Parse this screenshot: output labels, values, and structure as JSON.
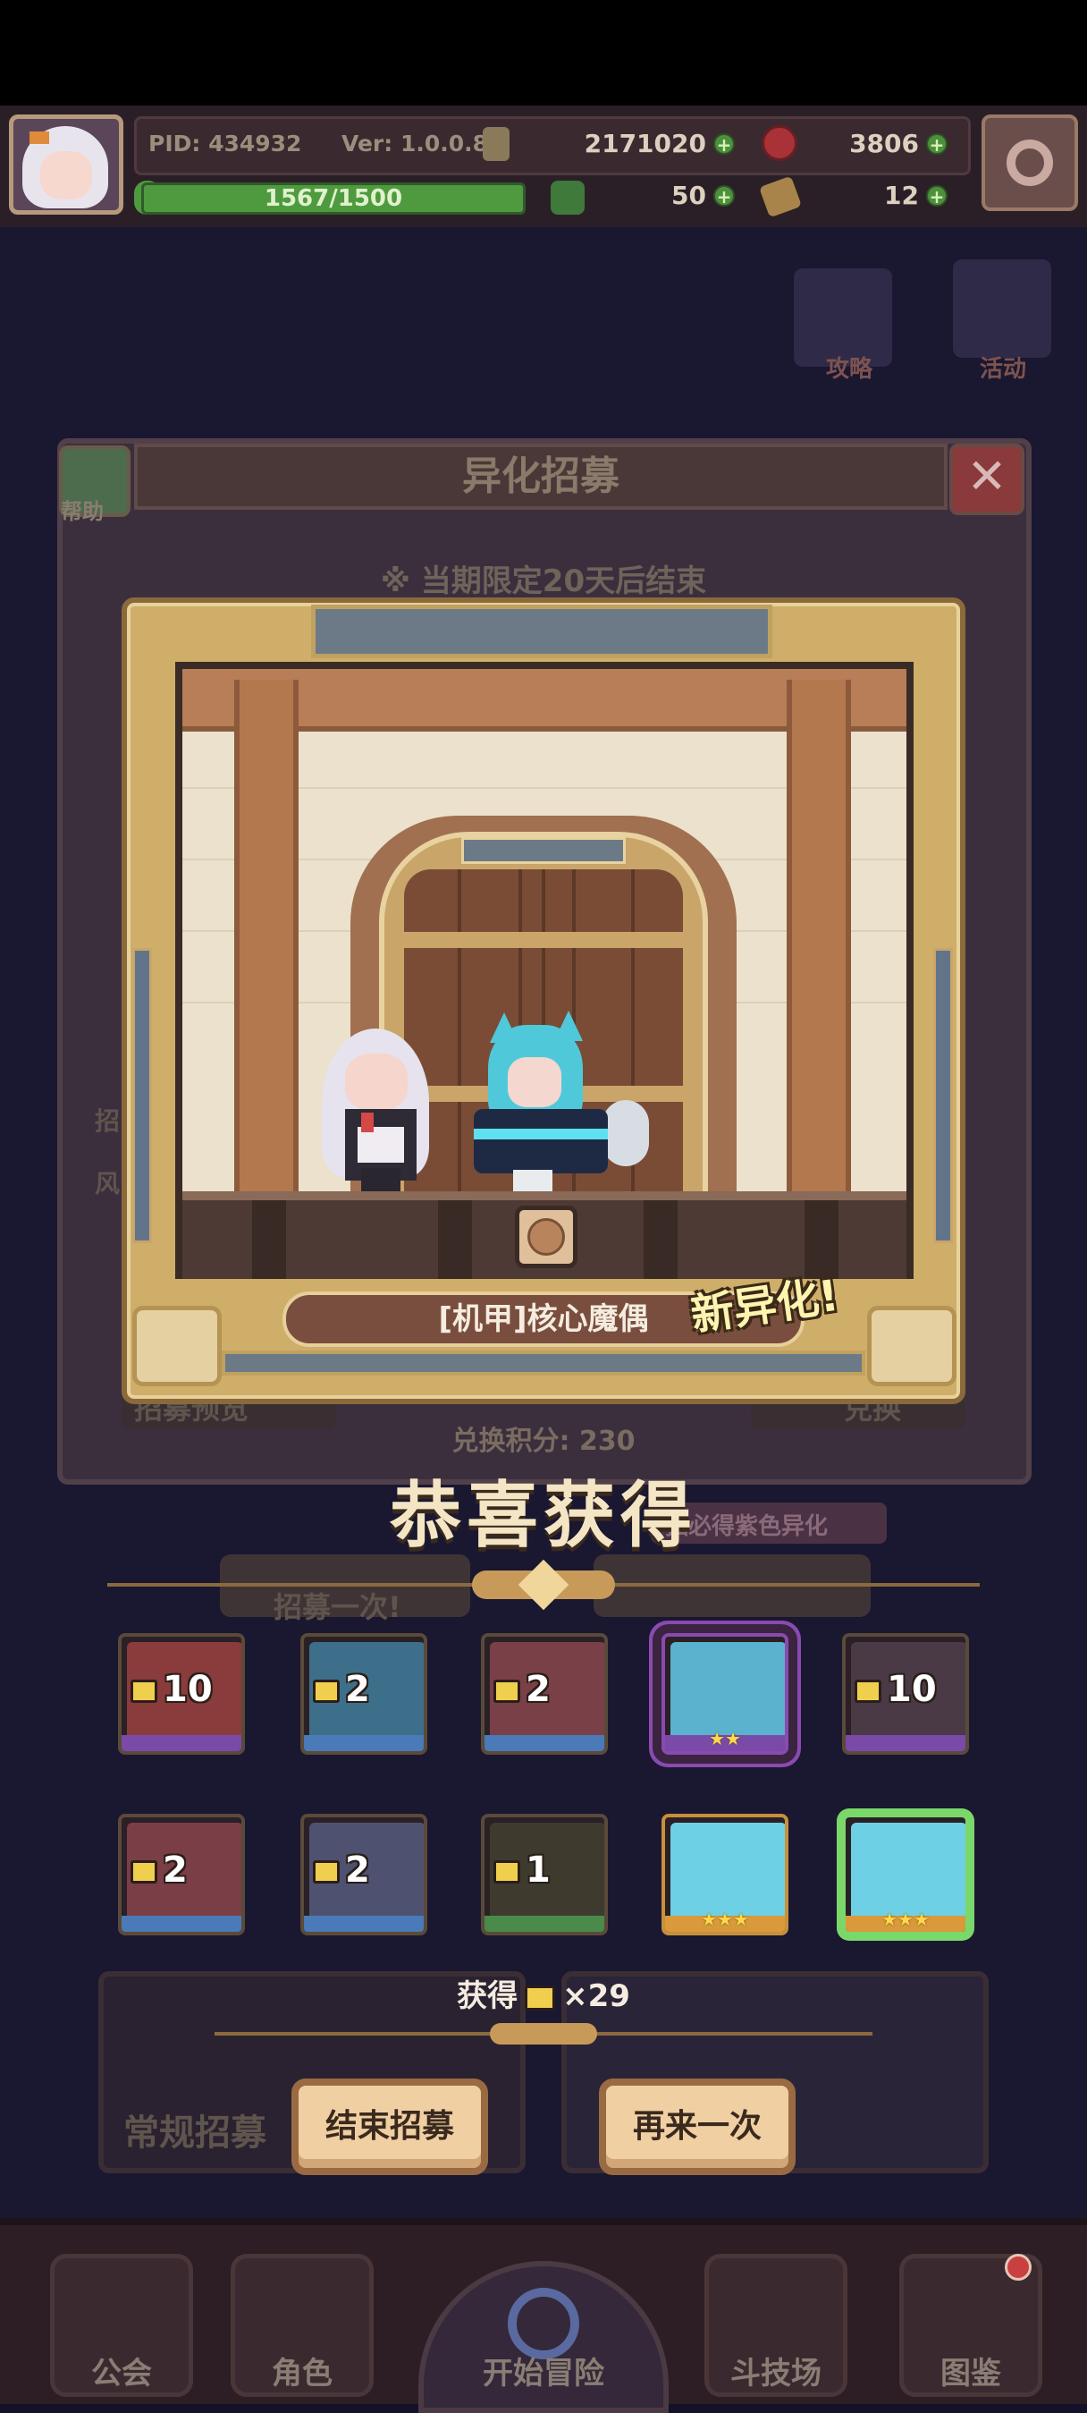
{
  "hud": {
    "pid": "PID: 434932",
    "version": "Ver: 1.0.0.8",
    "gold": "2171020",
    "gems": "3806",
    "exp_text": "1567/1500",
    "exp_fill": 1.0,
    "clover": "50",
    "keys": "12"
  },
  "side": {
    "guide_label": "攻略",
    "event_label": "活动"
  },
  "gacha_panel": {
    "title": "异化招募",
    "help_label": "帮助",
    "close_glyph": "✕",
    "notice": "※ 当期限定20天后结束",
    "preview_label": "招募预览",
    "exchange_label": "兑换",
    "guarantee_hint": "抽必得紫色异化",
    "recruit_once": "招募一次!",
    "side_letters": [
      "招",
      "风"
    ]
  },
  "reveal": {
    "unit_name": "[机甲]核心魔偶",
    "new_tag": "新异化!"
  },
  "points_text": "兑换积分: 230",
  "congrats": "恭喜获得",
  "results": [
    {
      "count": "10",
      "art_color": "#8a3b3b",
      "base_color": "#7a4aa8",
      "border": "#5a4a3a"
    },
    {
      "count": "2",
      "art_color": "#3e6f8a",
      "base_color": "#4a7ab8",
      "border": "#5a4a3a"
    },
    {
      "count": "2",
      "art_color": "#7a4048",
      "base_color": "#4a7ab8",
      "border": "#5a4a3a"
    },
    {
      "count": "",
      "stars": "★★",
      "art_color": "#5ab2cf",
      "base_color": "#7a4aa8",
      "border": "#8a4ab0",
      "highlight": true
    },
    {
      "count": "10",
      "art_color": "#4a3a46",
      "base_color": "#7a4aa8",
      "border": "#5a4a3a"
    },
    {
      "count": "2",
      "art_color": "#7a3e46",
      "base_color": "#4a7ab8",
      "border": "#5a4a3a"
    },
    {
      "count": "2",
      "art_color": "#4e5270",
      "base_color": "#4a7ab8",
      "border": "#5a4a3a"
    },
    {
      "count": "1",
      "art_color": "#3e3a2e",
      "base_color": "#4a8a4a",
      "border": "#5a4a3a"
    },
    {
      "count": "",
      "stars": "★★★",
      "art_color": "#6ed0e4",
      "base_color": "#d89a3a",
      "border": "#c8903a"
    },
    {
      "count": "",
      "stars": "★★★",
      "art_color": "#6ed0e4",
      "base_color": "#d89a3a",
      "border": "#7ad86a",
      "selected": true
    }
  ],
  "obtain": {
    "prefix": "获得",
    "suffix": "×29"
  },
  "bg_regular_recruit": "常规招募",
  "buttons": {
    "end_recruit": "结束招募",
    "again": "再来一次"
  },
  "nav": {
    "guild": "公会",
    "roles": "角色",
    "adventure": "开始冒险",
    "arena": "斗技场",
    "codex": "图鉴"
  },
  "colors": {
    "accent_gold": "#cfae6a",
    "new_tag": "#fff3b0",
    "highlight_purple": "#8a4ab0",
    "selected_green": "#7ad86a"
  }
}
